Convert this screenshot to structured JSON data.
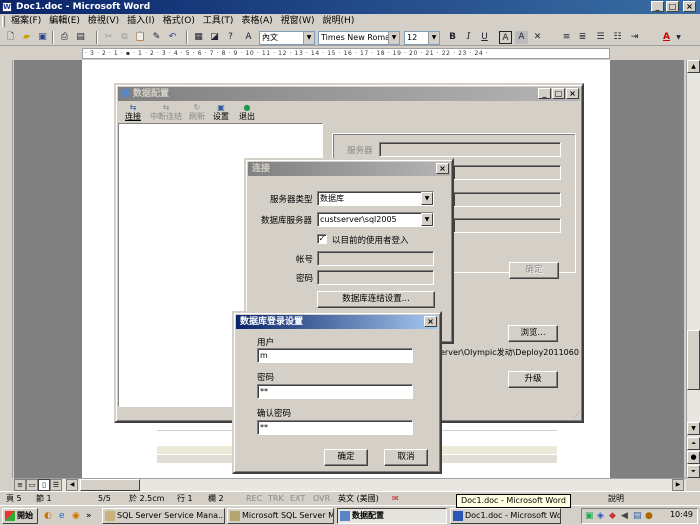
{
  "word": {
    "title": "Doc1.doc - Microsoft Word",
    "menu": [
      "檔案(F)",
      "編輯(E)",
      "檢視(V)",
      "插入(I)",
      "格式(O)",
      "工具(T)",
      "表格(A)",
      "視窗(W)",
      "說明(H)"
    ],
    "style_value": "內文",
    "font_value": "Times New Roman",
    "size_value": "12",
    "ruler_text": "· 3 · 2 · 1 · ▪ · 1 · 2 · 3 · 4 · 5 · 6 · 7 · 8 · 9 · 10 · 11 · 12 · 13 · 14 · 15 · 16 · 17 · 18 · 19 · 20 · 21 · 22 · 23 · 24 ·",
    "toolbar_labels": {
      "underline": "U",
      "bold": "B",
      "italic": "I",
      "font_color": "A"
    }
  },
  "status": {
    "page": "頁 5",
    "section": "節 1",
    "page_of": "5/5",
    "at": "於 2.5cm",
    "line": "行 1",
    "col": "欄 2",
    "rec": "REC",
    "trk": "TRK",
    "ext": "EXT",
    "ovr": "OVR",
    "lang": "英文 (美國)",
    "help": "說明"
  },
  "tooltip": "Doc1.doc - Microsoft Word",
  "taskbar": {
    "start": "開始",
    "buttons": [
      "SQL Server Service Mana...",
      "Microsoft SQL Server Ma...",
      "数据配置",
      "Doc1.doc - Microsoft Word"
    ],
    "clock": "10:49"
  },
  "data_config": {
    "title": "数据配置",
    "toolbar": [
      "连接",
      "中断连结",
      "刷新",
      "设置",
      "退出"
    ],
    "server_label": "服务器",
    "confirm": "确定",
    "browse": "浏览...",
    "path": "erver\\Olympic发动\\Deploy2011060",
    "upgrade": "升级"
  },
  "connect": {
    "title": "连接",
    "server_type_label": "服务器类型",
    "server_type_value": "数据库",
    "db_server_label": "数据库服务器",
    "db_server_value": "custserver\\sql2005",
    "use_current_user": "以目前的使用者登入",
    "account_label": "帐号",
    "password_label": "密码",
    "db_settings_button": "数据库连结设置..."
  },
  "login": {
    "title": "数据库登录设置",
    "user_label": "用户",
    "user_value": "m",
    "password_label": "密码",
    "password_value": "**",
    "confirm_label": "确认密码",
    "confirm_value": "**",
    "ok": "确定",
    "cancel": "取消"
  }
}
